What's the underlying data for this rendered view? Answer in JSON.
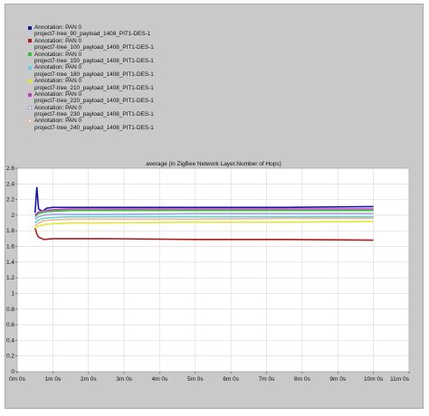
{
  "chart_data": {
    "type": "line",
    "title": "average (in ZigBee Network Layer.Number of Hops)",
    "xlabel": "",
    "ylabel": "",
    "x_tick_labels": [
      "0m 0s",
      "1m 0s",
      "2m 0s",
      "3m 0s",
      "4m 0s",
      "5m 0s",
      "6m 0s",
      "7m 0s",
      "8m 0s",
      "9m 0s",
      "10m 0s",
      "11m 0s"
    ],
    "y_tick_labels": [
      "0",
      "0.2",
      "0.4",
      "0.6",
      "0.8",
      "1",
      "1.2",
      "1.4",
      "1.6",
      "1.8",
      "2",
      "2.2",
      "2.4",
      "2.6"
    ],
    "xlim_seconds": [
      0,
      660
    ],
    "ylim": [
      0,
      2.6
    ],
    "grid": true,
    "legend_placement": "top-left",
    "series": [
      {
        "annotation": "Annotation: PAN 0",
        "name": "project7-tree_90_payload_1408_PIT1-DES-1",
        "color": "#1a1aa0",
        "filled": true,
        "points": [
          [
            30,
            2.03
          ],
          [
            33,
            2.36
          ],
          [
            36,
            2.08
          ],
          [
            42,
            2.05
          ],
          [
            50,
            2.09
          ],
          [
            60,
            2.1
          ],
          [
            90,
            2.1
          ],
          [
            150,
            2.1
          ],
          [
            300,
            2.1
          ],
          [
            450,
            2.1
          ],
          [
            600,
            2.11
          ]
        ]
      },
      {
        "annotation": "Annotation: PAN 0",
        "name": "project7-tree_100_payload_1408_PIT1-DES-1",
        "color": "#b01c1c",
        "filled": true,
        "points": [
          [
            30,
            1.84
          ],
          [
            33,
            1.76
          ],
          [
            36,
            1.72
          ],
          [
            45,
            1.69
          ],
          [
            60,
            1.7
          ],
          [
            90,
            1.7
          ],
          [
            150,
            1.7
          ],
          [
            300,
            1.69
          ],
          [
            450,
            1.69
          ],
          [
            600,
            1.68
          ]
        ]
      },
      {
        "annotation": "Annotation: PAN 0",
        "name": "project7-tree_150_payload_1408_PIT1-DES-1",
        "color": "#2ec22e",
        "filled": true,
        "points": [
          [
            30,
            1.98
          ],
          [
            36,
            2.02
          ],
          [
            45,
            2.04
          ],
          [
            60,
            2.05
          ],
          [
            90,
            2.06
          ],
          [
            150,
            2.06
          ],
          [
            300,
            2.06
          ],
          [
            450,
            2.06
          ],
          [
            600,
            2.06
          ]
        ]
      },
      {
        "annotation": "Annotation: PAN 0",
        "name": "project7-tree_180_payload_1408_PIT1-DES-1",
        "color": "#5fd3e0",
        "filled": true,
        "points": [
          [
            30,
            1.9
          ],
          [
            36,
            1.94
          ],
          [
            45,
            1.96
          ],
          [
            60,
            1.97
          ],
          [
            90,
            1.98
          ],
          [
            150,
            1.98
          ],
          [
            300,
            1.98
          ],
          [
            450,
            1.98
          ],
          [
            600,
            1.98
          ]
        ]
      },
      {
        "annotation": "Annotation: PAN 0",
        "name": "project7-tree_210_payload_1408_PIT1-DES-1",
        "color": "#e6e63a",
        "filled": true,
        "points": [
          [
            30,
            1.83
          ],
          [
            36,
            1.86
          ],
          [
            45,
            1.88
          ],
          [
            60,
            1.89
          ],
          [
            90,
            1.9
          ],
          [
            150,
            1.9
          ],
          [
            300,
            1.91
          ],
          [
            450,
            1.91
          ],
          [
            600,
            1.92
          ]
        ]
      },
      {
        "annotation": "Annotation: PAN 0",
        "name": "project7-tree_220_payload_1408_PIT1-DES-1",
        "color": "#c23ec2",
        "filled": true,
        "points": [
          [
            30,
            2.0
          ],
          [
            36,
            2.04
          ],
          [
            45,
            2.06
          ],
          [
            60,
            2.07
          ],
          [
            90,
            2.08
          ],
          [
            150,
            2.08
          ],
          [
            300,
            2.08
          ],
          [
            450,
            2.08
          ],
          [
            600,
            2.08
          ]
        ]
      },
      {
        "annotation": "Annotation: PAN 0",
        "name": "project7-tree_230_payload_1408_PIT1-DES-1",
        "color": "#9fa8e0",
        "filled": false,
        "points": [
          [
            30,
            1.95
          ],
          [
            36,
            1.98
          ],
          [
            45,
            2.0
          ],
          [
            60,
            2.01
          ],
          [
            90,
            2.01
          ],
          [
            150,
            2.01
          ],
          [
            300,
            2.02
          ],
          [
            450,
            2.02
          ],
          [
            600,
            2.02
          ]
        ]
      },
      {
        "annotation": "Annotation: PAN 0",
        "name": "project7-tree_240_payload_1408_PIT1-DES-1",
        "color": "#f0b890",
        "filled": false,
        "points": [
          [
            30,
            1.86
          ],
          [
            36,
            1.9
          ],
          [
            45,
            1.93
          ],
          [
            60,
            1.94
          ],
          [
            90,
            1.95
          ],
          [
            150,
            1.95
          ],
          [
            300,
            1.95
          ],
          [
            450,
            1.96
          ],
          [
            600,
            1.96
          ]
        ]
      }
    ]
  }
}
